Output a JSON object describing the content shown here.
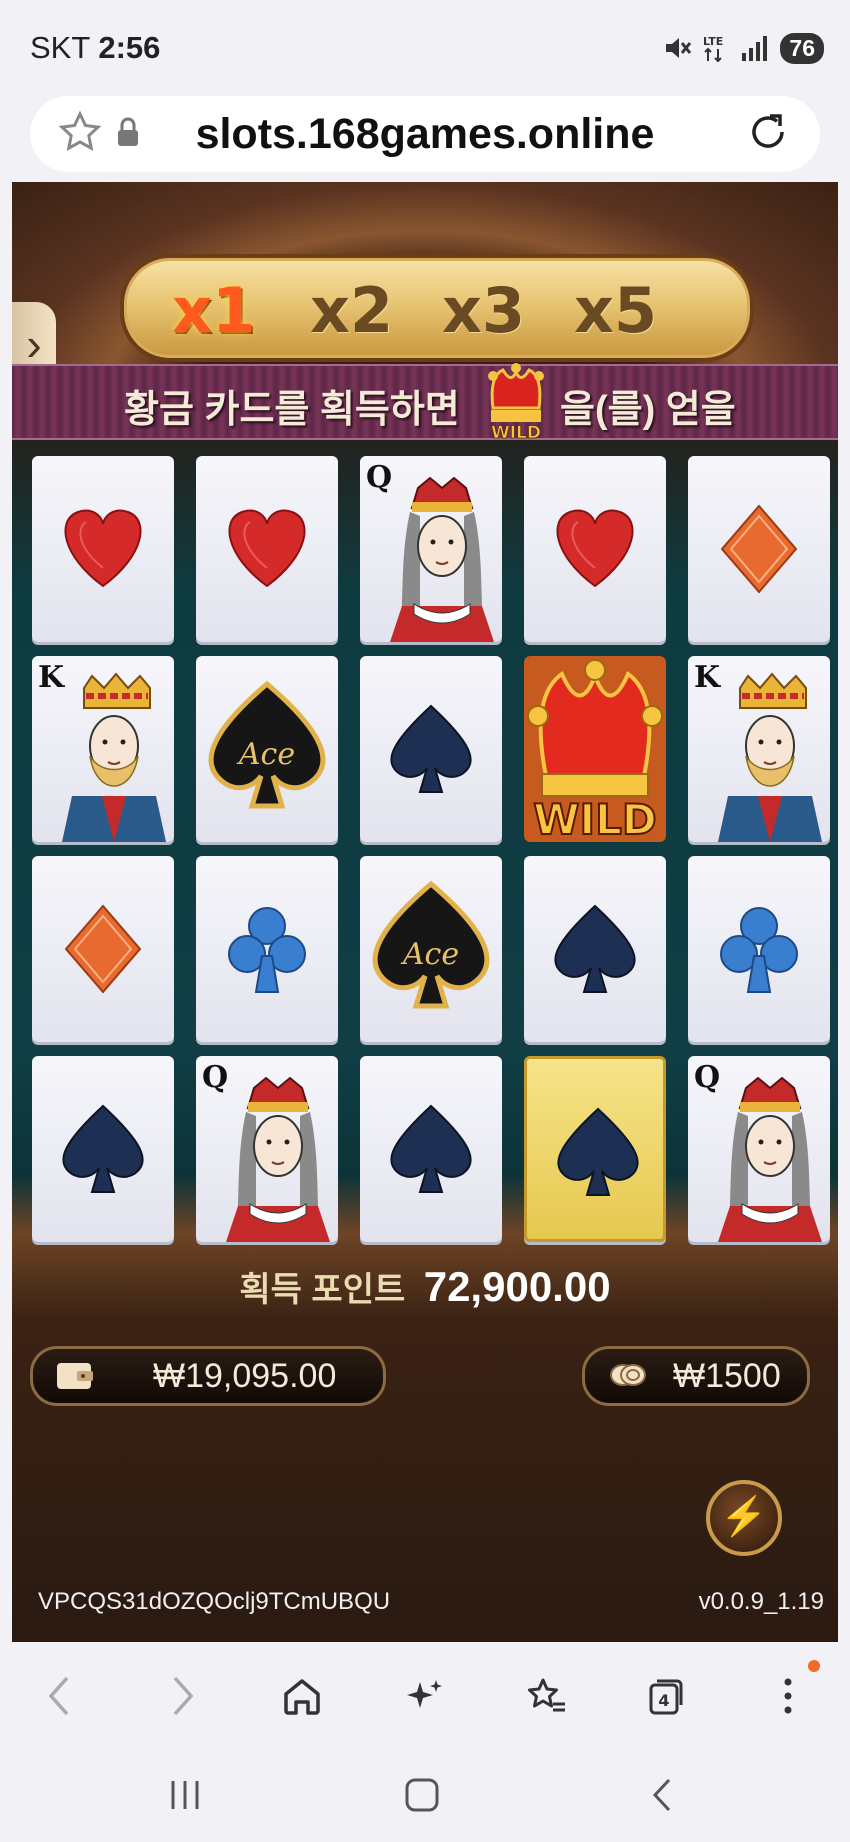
{
  "status": {
    "carrier": "SKT",
    "time": "2:56",
    "battery": "76"
  },
  "browser": {
    "url": "slots.168games.online"
  },
  "game": {
    "multipliers": [
      "x1",
      "x2",
      "x3",
      "x5"
    ],
    "active_multiplier": "x1",
    "banner_before": "황금 카드를 획득하면",
    "banner_after": "을(를) 얻을",
    "wild_label": "WILD",
    "points_label": "획득 포인트",
    "points_value": "72,900.00",
    "balance": "₩19,095.00",
    "bet": "₩1500",
    "session_id": "VPCQS31dOZQOclj9TCmUBQU",
    "version": "v0.0.9_1.19",
    "grid": [
      [
        "heart",
        "heart",
        "queen",
        "heart",
        "diamond"
      ],
      [
        "king",
        "ace",
        "spade",
        "wild",
        "king"
      ],
      [
        "diamond",
        "club",
        "ace",
        "spade",
        "club"
      ],
      [
        "spade",
        "queen",
        "spade",
        "gold-spade",
        "queen"
      ]
    ],
    "card_letters": {
      "queen": "Q",
      "king": "K"
    },
    "ace_text": "Ace"
  },
  "nav": {
    "tabs_count": "4"
  },
  "icons": {
    "back": "chevron-left-icon",
    "forward": "chevron-right-icon",
    "home": "home-icon",
    "ai": "sparkle-icon",
    "bookmarks": "star-list-icon",
    "tabs": "tabs-icon",
    "menu": "more-vert-icon"
  },
  "colors": {
    "felt": "#0e3b40",
    "wood": "#5a3320",
    "gold": "#e8c574",
    "active_multiplier": "#ff5a1e"
  }
}
